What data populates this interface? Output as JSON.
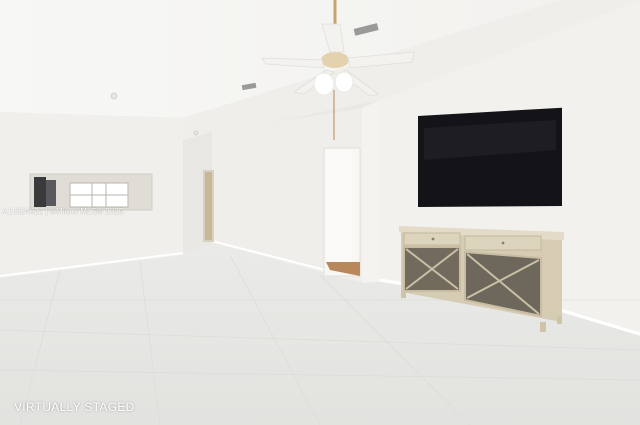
{
  "photo": {
    "watermark": "A11834622 | ©Miami MLS® 2025",
    "caption": "VIRTUALLY STAGED"
  },
  "colors": {
    "wall": "#f1f0ec",
    "ceiling": "#f6f5f2",
    "floor": "#e6e6e4",
    "tv": "#141418",
    "cabinet": "#d9cfb7"
  }
}
